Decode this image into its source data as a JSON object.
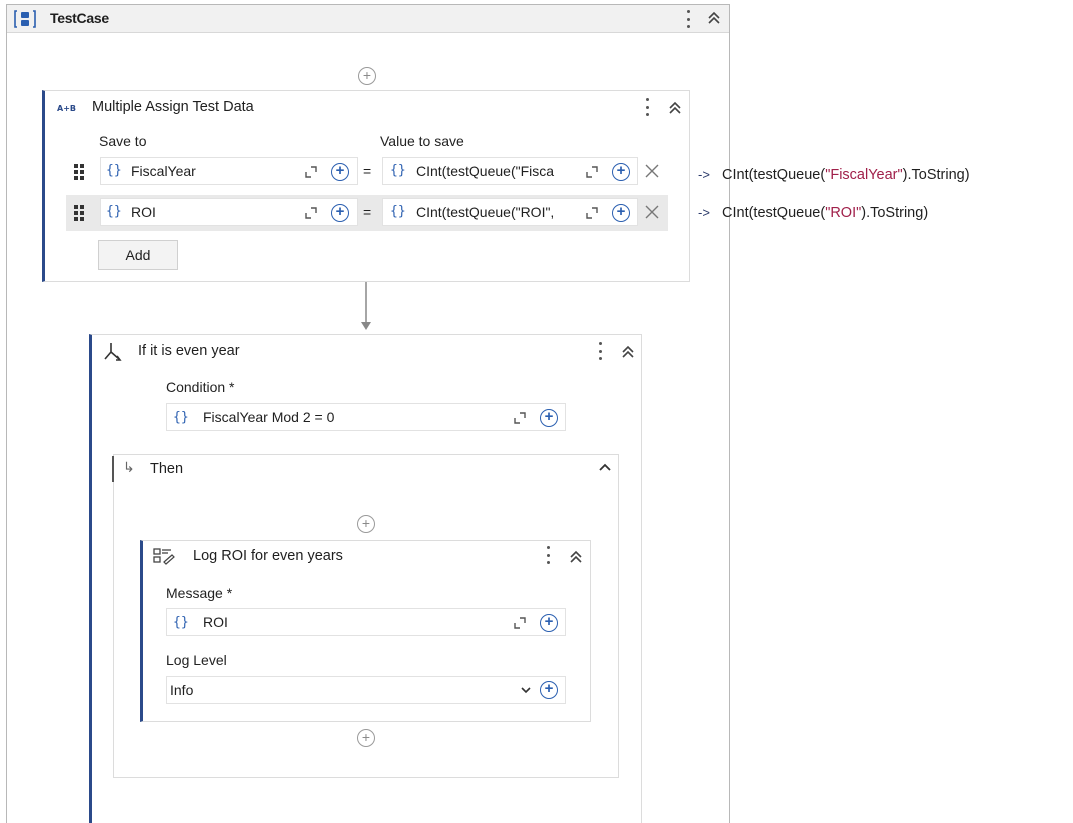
{
  "workflow": {
    "title": "TestCase"
  },
  "assign": {
    "title": "Multiple Assign Test Data",
    "save_to_label": "Save to",
    "value_label": "Value to save",
    "rows": [
      {
        "to": "FiscalYear",
        "value": "CInt(testQueue(\"Fisca"
      },
      {
        "to": "ROI",
        "value": "CInt(testQueue(\"ROI\","
      }
    ],
    "add_label": "Add",
    "equals": "="
  },
  "annotations": [
    {
      "arrow": "->",
      "pre": "CInt(testQueue(",
      "str": "\"FiscalYear\"",
      "post": ").ToString)"
    },
    {
      "arrow": "->",
      "pre": "CInt(testQueue(",
      "str": "\"ROI\"",
      "post": ").ToString)"
    }
  ],
  "if_activity": {
    "title": "If it is even year",
    "condition_label": "Condition *",
    "condition_value": "FiscalYear Mod 2 = 0",
    "then_label": "Then"
  },
  "log": {
    "title": "Log ROI for even years",
    "message_label": "Message *",
    "message_value": "ROI",
    "level_label": "Log Level",
    "level_value": "Info"
  },
  "icons": {
    "sequence": "sequence-icon",
    "assign": "assign-icon",
    "if": "if-branch-icon",
    "log": "log-message-icon"
  },
  "colors": {
    "accent": "#2b4a8a",
    "brace": "#2b5fb0",
    "string_literal": "#a0204a"
  }
}
